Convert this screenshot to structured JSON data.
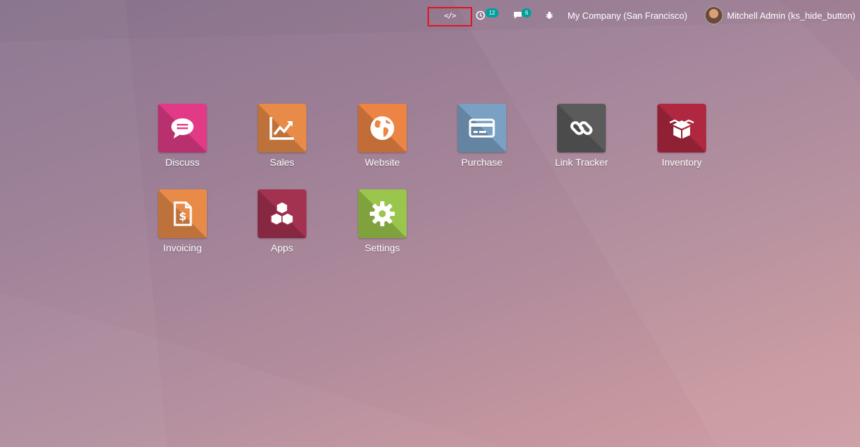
{
  "navbar": {
    "dev_tools_icon": "code-icon",
    "dev_tools_glyph": "</>",
    "activity_count": "12",
    "messages_count": "6",
    "debug_icon": "bug-icon",
    "company": "My Company (San Francisco)",
    "user": "Mitchell Admin (ks_hide_button)"
  },
  "apps": [
    {
      "label": "Discuss",
      "icon": "chat-bubble-icon",
      "color": "#e23a87"
    },
    {
      "label": "Sales",
      "icon": "trend-up-icon",
      "color": "#e88b48"
    },
    {
      "label": "Website",
      "icon": "globe-icon",
      "color": "#ec8444"
    },
    {
      "label": "Purchase",
      "icon": "credit-card-icon",
      "color": "#7aa1c4"
    },
    {
      "label": "Link Tracker",
      "icon": "link-icon",
      "color": "#5b5b5b"
    },
    {
      "label": "Inventory",
      "icon": "box-icon",
      "color": "#b0283f"
    },
    {
      "label": "Invoicing",
      "icon": "invoice-dollar-icon",
      "color": "#e88b48"
    },
    {
      "label": "Apps",
      "icon": "cubes-icon",
      "color": "#a33150"
    },
    {
      "label": "Settings",
      "icon": "gear-icon",
      "color": "#9bc64d"
    }
  ],
  "colors": {
    "highlight": "#e0141e",
    "badge": "#00a09d"
  }
}
